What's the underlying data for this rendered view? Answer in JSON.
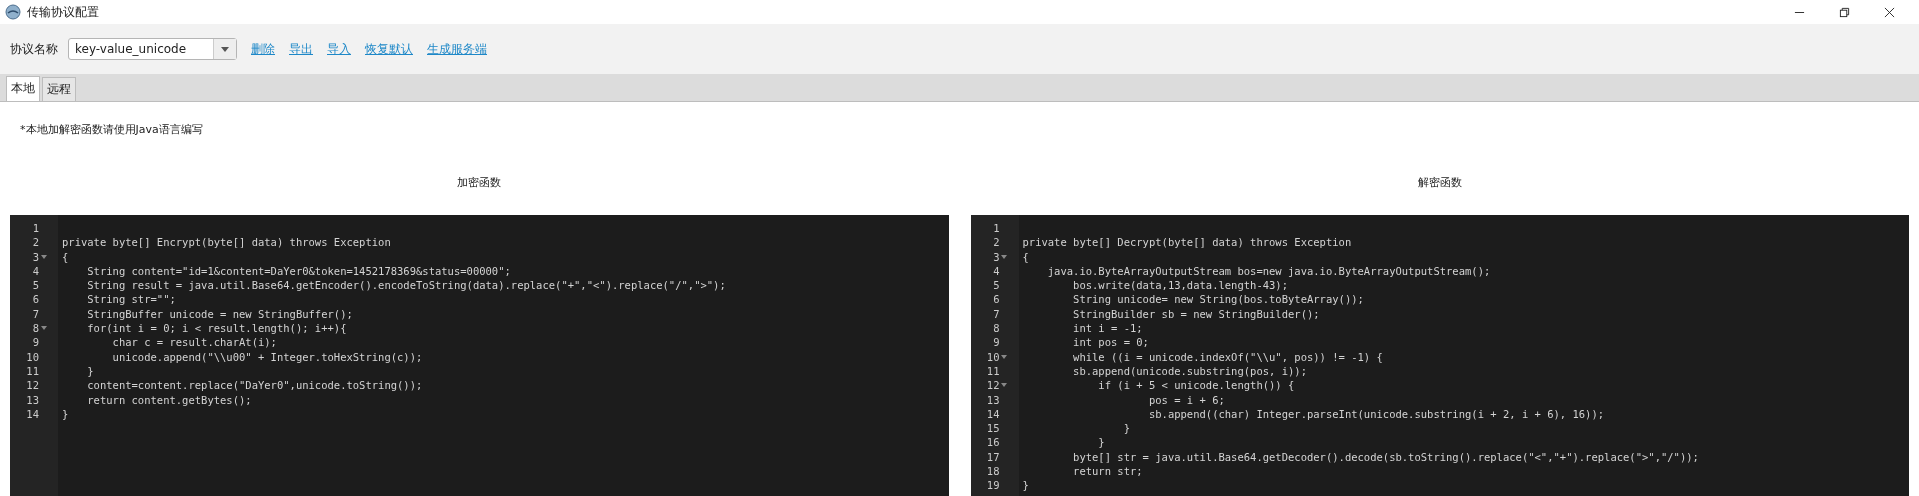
{
  "window": {
    "title": "传输协议配置"
  },
  "toolbar": {
    "label": "协议名称",
    "protocol": "key-value_unicode",
    "links": [
      "删除",
      "导出",
      "导入",
      "恢复默认",
      "生成服务端"
    ]
  },
  "tabs": [
    {
      "label": "本地",
      "selected": true
    },
    {
      "label": "远程",
      "selected": false
    }
  ],
  "note": "*本地加解密函数请使用Java语言编写",
  "editors": [
    {
      "heading": "加密函数",
      "lines": [
        {
          "n": "1",
          "fold": false
        },
        {
          "n": "2",
          "text": "private byte[] Encrypt(byte[] data) throws Exception",
          "fold": false
        },
        {
          "n": "3",
          "text": "{",
          "fold": true
        },
        {
          "n": "4",
          "text": "    String content=\"id=1&content=DaYer0&token=1452178369&status=00000\";",
          "fold": false
        },
        {
          "n": "5",
          "text": "    String result = java.util.Base64.getEncoder().encodeToString(data).replace(\"+\",\"<\").replace(\"/\",\">\");",
          "fold": false
        },
        {
          "n": "6",
          "text": "    String str=\"\";",
          "fold": false
        },
        {
          "n": "7",
          "text": "    StringBuffer unicode = new StringBuffer();",
          "fold": false
        },
        {
          "n": "8",
          "text": "    for(int i = 0; i < result.length(); i++){",
          "fold": true
        },
        {
          "n": "9",
          "text": "        char c = result.charAt(i);",
          "fold": false
        },
        {
          "n": "10",
          "text": "        unicode.append(\"\\\\u00\" + Integer.toHexString(c));",
          "fold": false
        },
        {
          "n": "11",
          "text": "    }",
          "fold": false
        },
        {
          "n": "12",
          "text": "    content=content.replace(\"DaYer0\",unicode.toString());",
          "fold": false
        },
        {
          "n": "13",
          "text": "    return content.getBytes();",
          "fold": false
        },
        {
          "n": "14",
          "text": "}",
          "fold": false
        }
      ]
    },
    {
      "heading": "解密函数",
      "lines": [
        {
          "n": "1",
          "fold": false
        },
        {
          "n": "2",
          "text": "private byte[] Decrypt(byte[] data) throws Exception",
          "fold": false
        },
        {
          "n": "3",
          "text": "{",
          "fold": true
        },
        {
          "n": "4",
          "text": "    java.io.ByteArrayOutputStream bos=new java.io.ByteArrayOutputStream();",
          "fold": false
        },
        {
          "n": "5",
          "text": "        bos.write(data,13,data.length-43);",
          "fold": false
        },
        {
          "n": "6",
          "text": "        String unicode= new String(bos.toByteArray());",
          "fold": false
        },
        {
          "n": "7",
          "text": "        StringBuilder sb = new StringBuilder();",
          "fold": false
        },
        {
          "n": "8",
          "text": "        int i = -1;",
          "fold": false
        },
        {
          "n": "9",
          "text": "        int pos = 0;",
          "fold": false
        },
        {
          "n": "10",
          "text": "        while ((i = unicode.indexOf(\"\\\\u\", pos)) != -1) {",
          "fold": true
        },
        {
          "n": "11",
          "text": "        sb.append(unicode.substring(pos, i));",
          "fold": false
        },
        {
          "n": "12",
          "text": "            if (i + 5 < unicode.length()) {",
          "fold": true
        },
        {
          "n": "13",
          "text": "                    pos = i + 6;",
          "fold": false
        },
        {
          "n": "14",
          "text": "                    sb.append((char) Integer.parseInt(unicode.substring(i + 2, i + 6), 16));",
          "fold": false
        },
        {
          "n": "15",
          "text": "                }",
          "fold": false
        },
        {
          "n": "16",
          "text": "            }",
          "fold": false
        },
        {
          "n": "17",
          "text": "        byte[] str = java.util.Base64.getDecoder().decode(sb.toString().replace(\"<\",\"+\").replace(\">\",\"/\"));",
          "fold": false
        },
        {
          "n": "18",
          "text": "        return str;",
          "fold": false
        },
        {
          "n": "19",
          "text": "}",
          "fold": false
        }
      ]
    }
  ]
}
